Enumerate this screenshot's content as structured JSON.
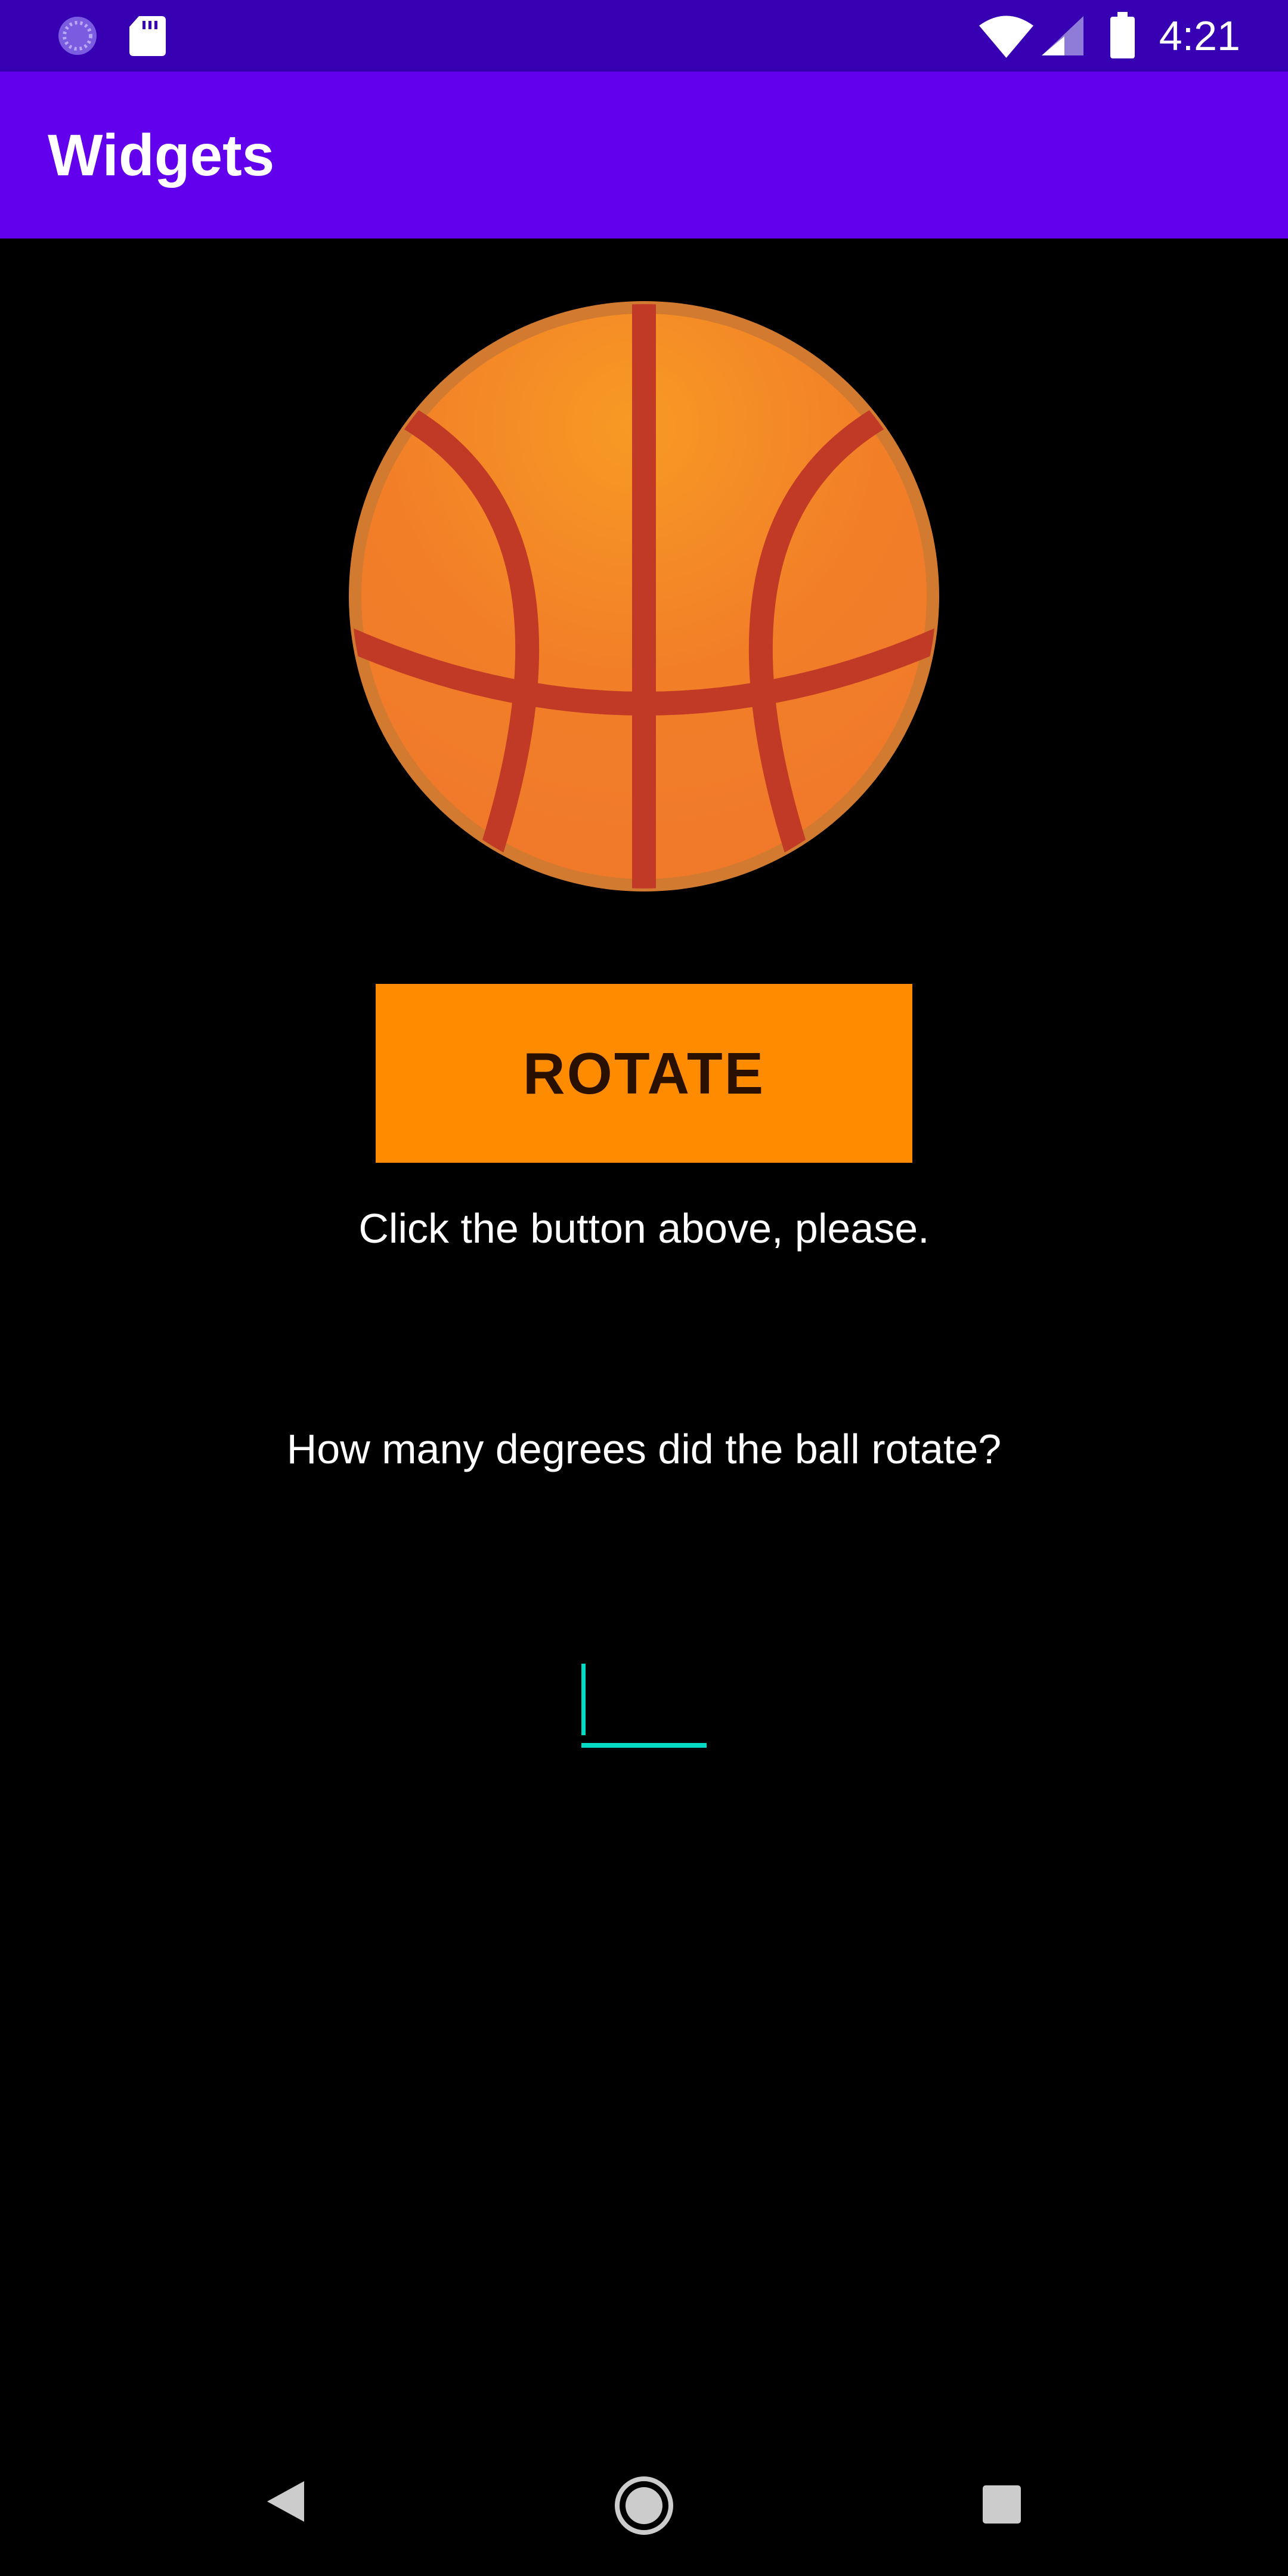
{
  "status_bar": {
    "time": "4:21",
    "icons": [
      "loading-spinner-icon",
      "sd-card-icon",
      "wifi-icon",
      "cell-signal-icon",
      "battery-icon"
    ]
  },
  "app_bar": {
    "title": "Widgets"
  },
  "ball": {
    "icon": "basketball-icon"
  },
  "rotate_button": {
    "label": "ROTATE"
  },
  "hint": {
    "text": "Click the button above, please."
  },
  "question": {
    "text": "How many degrees did the ball rotate?"
  },
  "answer": {
    "value": ""
  },
  "nav_bar": {
    "buttons": [
      "back-icon",
      "home-icon",
      "recents-icon"
    ]
  },
  "colors": {
    "status_bar": "#3700B3",
    "app_bar": "#6200EE",
    "button": "#FF8C00",
    "accent": "#03DAC5",
    "ball": "#F28A2E",
    "ball_lines": "#C13A26"
  }
}
